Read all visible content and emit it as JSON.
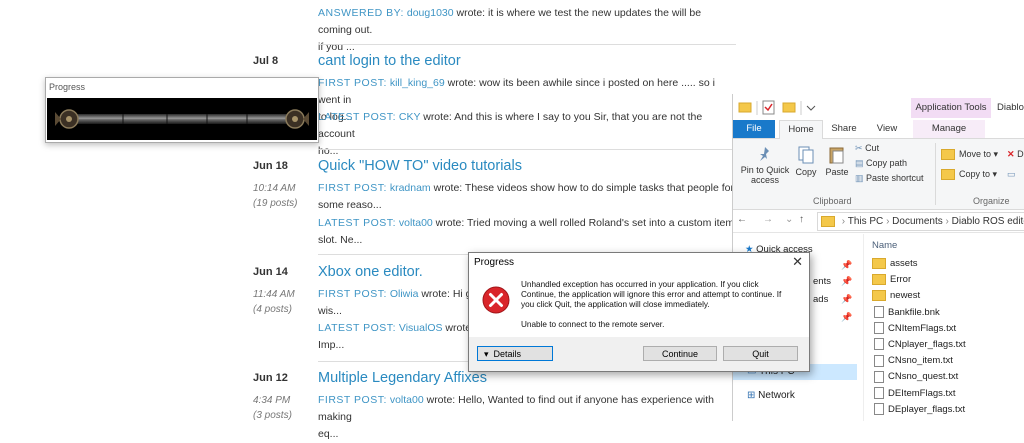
{
  "forum": {
    "top_post": {
      "kind": "ANSWERED BY",
      "author": "doug1030",
      "text": " wrote: it is where we test the new updates the will be coming out.",
      "cont": "if you ..."
    },
    "threads": [
      {
        "date": "Jul 8",
        "time": "",
        "posts": "",
        "title": "cant login to the editor",
        "first": {
          "kind": "FIRST POST",
          "author": "kill_king_69",
          "text": " wrote: wow its been awhile since i posted on here ..... so i went in",
          "cont": "to log..."
        },
        "latest": {
          "kind": "LATEST POST",
          "author": "CKY",
          "text": " wrote: And this is where I say to you Sir, that you are not the account",
          "cont": "ho..."
        }
      },
      {
        "date": "Jun 18",
        "time": "10:14 AM",
        "posts": "(19 posts)",
        "title": "Quick \"HOW TO\" video tutorials",
        "first": {
          "kind": "FIRST POST",
          "author": "kradnam",
          "text": " wrote: These videos show how to do simple tasks that people for",
          "cont": "some reaso..."
        },
        "latest": {
          "kind": "LATEST POST",
          "author": "volta00",
          "text": " wrote: Tried moving a well rolled Roland's set into a custom item",
          "cont": "slot. Ne..."
        }
      },
      {
        "date": "Jun 14",
        "time": "11:44 AM",
        "posts": "(4 posts)",
        "title": "Xbox one editor.",
        "first": {
          "kind": "FIRST POST",
          "author": "Oliwia",
          "text": " wrote: Hi gu",
          "cont": "wis..."
        },
        "latest": {
          "kind": "LATEST POST",
          "author": "VisualOS",
          "text": " wrote: Iter",
          "cont": "Imp..."
        }
      },
      {
        "date": "Jun 12",
        "time": "4:34 PM",
        "posts": "(3 posts)",
        "title": "Multiple Legendary Affixes",
        "first": {
          "kind": "FIRST POST",
          "author": "volta00",
          "text": " wrote: Hello, Wanted to find out if anyone has experience with making",
          "cont": "eq..."
        },
        "latest": null
      }
    ]
  },
  "mini_progress": {
    "title": "Progress"
  },
  "explorer": {
    "title": "Diablo",
    "app_tools": "Application Tools",
    "tabs": {
      "file": "File",
      "home": "Home",
      "share": "Share",
      "view": "View",
      "manage": "Manage"
    },
    "ribbon": {
      "pin": "Pin to Quick access",
      "copy": "Copy",
      "paste": "Paste",
      "cut": "Cut",
      "copy_path": "Copy path",
      "paste_shortcut": "Paste shortcut",
      "clipboard": "Clipboard",
      "move_to": "Move to",
      "copy_to": "Copy to",
      "delete": "D",
      "organize": "Organize"
    },
    "address": [
      "This PC",
      "Documents",
      "Diablo ROS edito"
    ],
    "nav": {
      "quick_access": "Quick access",
      "this_pc": "This PC",
      "network": "Network",
      "n1": "ents",
      "n2": "ads"
    },
    "column_name": "Name",
    "files": [
      {
        "name": "assets",
        "type": "folder"
      },
      {
        "name": "Error",
        "type": "folder"
      },
      {
        "name": "newest",
        "type": "folder"
      },
      {
        "name": "Bankfile.bnk",
        "type": "file"
      },
      {
        "name": "CNItemFlags.txt",
        "type": "file"
      },
      {
        "name": "CNplayer_flags.txt",
        "type": "file"
      },
      {
        "name": "CNsno_item.txt",
        "type": "file"
      },
      {
        "name": "CNsno_quest.txt",
        "type": "file"
      },
      {
        "name": "DEItemFlags.txt",
        "type": "file"
      },
      {
        "name": "DEplayer_flags.txt",
        "type": "file"
      }
    ]
  },
  "dialog": {
    "title": "Progress",
    "message": "Unhandled exception has occurred in your application. If you click Continue, the application will ignore this error and attempt to continue. If you click Quit, the application will close immediately.",
    "detail": "Unable to connect to the remote server.",
    "details_label": "Details",
    "continue_label": "Continue",
    "quit_label": "Quit"
  },
  "colors": {
    "link": "#2a8ac0",
    "accent": "#1979ca",
    "error": "#d9252a",
    "folder": "#f4c84a"
  }
}
